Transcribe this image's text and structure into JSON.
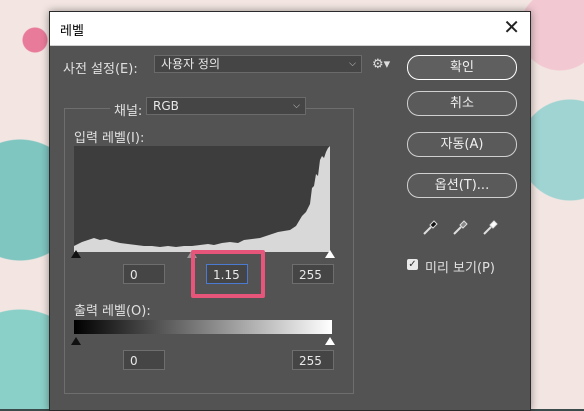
{
  "dialog": {
    "title": "레벨",
    "close_glyph": "✕"
  },
  "preset": {
    "label": "사전 설정(E):",
    "value": "사용자 정의"
  },
  "channel": {
    "label": "채널:",
    "value": "RGB"
  },
  "input_levels": {
    "label": "입력 레벨(I):",
    "black": "0",
    "gamma": "1.15",
    "white": "255"
  },
  "output_levels": {
    "label": "출력 레벨(O):",
    "black": "0",
    "white": "255"
  },
  "buttons": {
    "ok": "확인",
    "cancel": "취소",
    "auto": "자동(A)",
    "options": "옵션(T)..."
  },
  "preview": {
    "label": "미리 보기(P)",
    "checked": true
  },
  "icons": {
    "gear": "gear-icon",
    "dropper_black": "eyedropper-black-icon",
    "dropper_gray": "eyedropper-gray-icon",
    "dropper_white": "eyedropper-white-icon"
  },
  "colors": {
    "dialog_bg": "#535353",
    "highlight": "#e8557b"
  }
}
